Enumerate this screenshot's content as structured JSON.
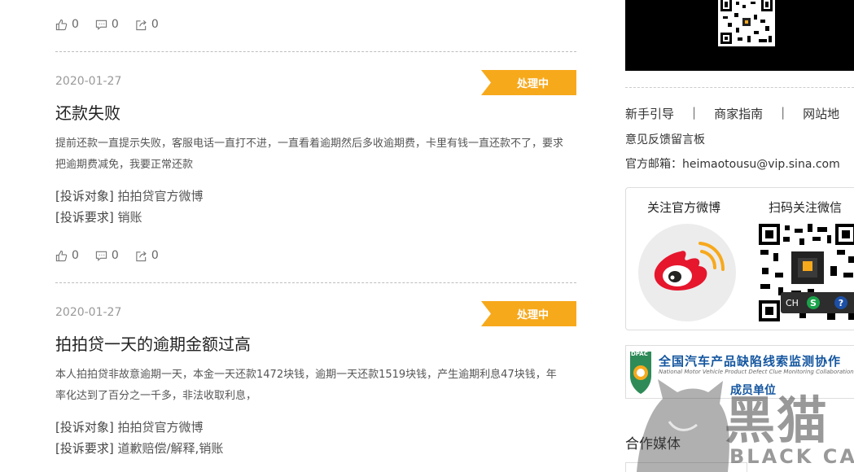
{
  "top_actions": {
    "likes": "0",
    "comments": "0",
    "shares": "0"
  },
  "complaints": [
    {
      "date": "2020-01-27",
      "status": "处理中",
      "title": "还款失败",
      "description": "提前还款一直提示失败，客服电话一直打不进，一直看着逾期然后多收逾期费，卡里有钱一直还款不了，要求把逾期费减免，我要正常还款",
      "target_label": "[投诉对象]",
      "target_value": "拍拍贷官方微博",
      "request_label": "[投诉要求]",
      "request_value": "销账",
      "likes": "0",
      "comments": "0",
      "shares": "0"
    },
    {
      "date": "2020-01-27",
      "status": "处理中",
      "title": "拍拍贷一天的逾期金额过高",
      "description": "本人拍拍贷非故意逾期一天，本金一天还款1472块钱，逾期一天还款1519块钱，产生逾期利息47块钱，年率化达到了百分之一千多，非法收取利息，",
      "target_label": "[投诉对象]",
      "target_value": "拍拍贷官方微博",
      "request_label": "[投诉要求]",
      "request_value": "道歉赔偿/解释,销账"
    }
  ],
  "sidebar": {
    "nav": [
      "新手引导",
      "商家指南",
      "网站地"
    ],
    "nav_separator": "|",
    "feedback": "意见反馈留言板",
    "email": "官方邮箱：heimaotousu@vip.sina.com",
    "follow_weibo": "关注官方微博",
    "follow_wechat": "扫码关注微信",
    "ime": {
      "lang": "CH",
      "s": "S",
      "help": "?"
    },
    "dpac": {
      "badge": "DPAC",
      "title": "全国汽车产品缺陷线索监测协作",
      "subtitle": "National Motor Vehicle Product Defect Clue Monitoring Collaboration Net",
      "member": "成员单位"
    },
    "partner_title": "合作媒体"
  },
  "watermark": {
    "cn": "黑猫",
    "en": "BLACK CAT"
  },
  "colors": {
    "status_bg": "#f7a91c",
    "weibo_red": "#e6162d",
    "dpac_blue": "#1456a0"
  }
}
